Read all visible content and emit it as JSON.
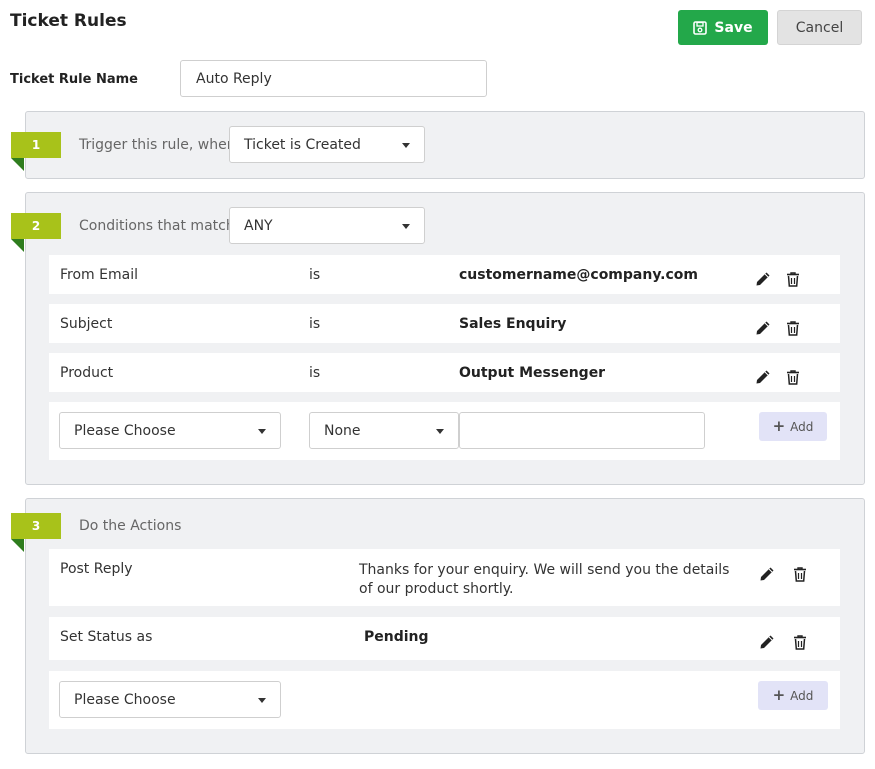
{
  "header": {
    "title": "Ticket Rules",
    "save_label": "Save",
    "cancel_label": "Cancel"
  },
  "rule_name": {
    "label": "Ticket Rule Name",
    "value": "Auto Reply"
  },
  "trigger": {
    "step": "1",
    "label": "Trigger this rule, when",
    "selected": "Ticket is Created"
  },
  "conditions": {
    "step": "2",
    "label": "Conditions that match",
    "match": "ANY",
    "rows": [
      {
        "field": "From Email",
        "operator": "is",
        "value": "customername@company.com"
      },
      {
        "field": "Subject",
        "operator": "is",
        "value": "Sales Enquiry"
      },
      {
        "field": "Product",
        "operator": "is",
        "value": "Output Messenger"
      }
    ],
    "new_row": {
      "field_select": "Please Choose",
      "operator_select": "None",
      "value": "",
      "add_label": "Add"
    }
  },
  "actions": {
    "step": "3",
    "label": "Do the Actions",
    "rows": [
      {
        "action": "Post Reply",
        "value": "Thanks for your enquiry. We will send you the details of our product shortly."
      },
      {
        "action": "Set Status as",
        "value": "Pending"
      }
    ],
    "new_row": {
      "action_select": "Please Choose",
      "add_label": "Add"
    }
  },
  "icons": {
    "save": "floppy-disk-icon",
    "edit": "pencil-icon",
    "delete": "trash-icon",
    "dropdown": "caret-down-icon",
    "add": "plus-icon"
  },
  "colors": {
    "save_button": "#23a84a",
    "step_badge": "#a8c21a",
    "step_fold": "#2f7d1e",
    "panel_bg": "#f0f1f3",
    "add_button": "#e2e3f7"
  }
}
